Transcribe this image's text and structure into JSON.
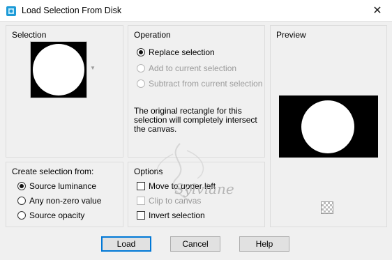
{
  "window": {
    "title": "Load Selection From Disk",
    "close_glyph": "✕"
  },
  "selection_group": {
    "title": "Selection"
  },
  "operation_group": {
    "title": "Operation",
    "options": [
      {
        "label": "Replace selection",
        "checked": true,
        "enabled": true
      },
      {
        "label": "Add to current selection",
        "checked": false,
        "enabled": false
      },
      {
        "label": "Subtract from current selection",
        "checked": false,
        "enabled": false
      }
    ],
    "info_text": "The original rectangle for this selection will completely intersect the canvas."
  },
  "preview_group": {
    "title": "Preview"
  },
  "create_group": {
    "title": "Create selection from:",
    "options": [
      {
        "label": "Source luminance",
        "checked": true
      },
      {
        "label": "Any non-zero value",
        "checked": false
      },
      {
        "label": "Source opacity",
        "checked": false
      }
    ]
  },
  "options_group": {
    "title": "Options",
    "items": [
      {
        "label": "Move to upper left",
        "checked": false,
        "enabled": true
      },
      {
        "label": "Clip to canvas",
        "checked": false,
        "enabled": false
      },
      {
        "label": "Invert selection",
        "checked": false,
        "enabled": true
      }
    ]
  },
  "buttons": {
    "load": "Load",
    "cancel": "Cancel",
    "help": "Help"
  },
  "watermark": {
    "text": "Sylviane"
  },
  "colors": {
    "accent": "#0078d7",
    "dialog_bg": "#f0f0f0",
    "titlebar_bg": "#ffffff"
  },
  "icons": {
    "app": "app-icon",
    "close": "close-icon",
    "dropdown": "chevron-down-icon",
    "preview_toggle": "checkerboard-icon"
  }
}
